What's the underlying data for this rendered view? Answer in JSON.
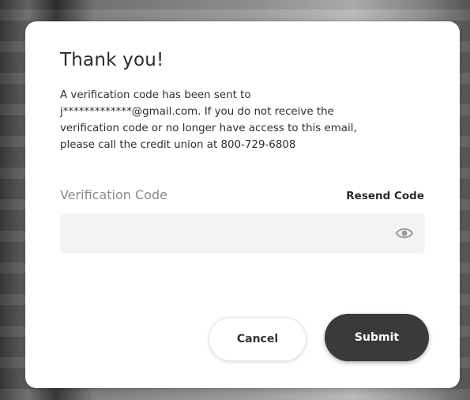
{
  "dialog": {
    "title": "Thank you!",
    "message_lines": [
      "A verification code has been sent to",
      "j*************@gmail.com. If you do not receive the",
      "verification code or no longer have access to this email,",
      "please call the credit union at 800-729-6808"
    ],
    "field_label": "Verification Code",
    "resend_label": "Resend Code",
    "input_value": "",
    "visibility_icon": "eye-icon",
    "cancel_label": "Cancel",
    "submit_label": "Submit"
  },
  "colors": {
    "submit_bg": "#3a3a3a",
    "input_bg": "#f3f3f3",
    "label": "#8a8a8a"
  }
}
